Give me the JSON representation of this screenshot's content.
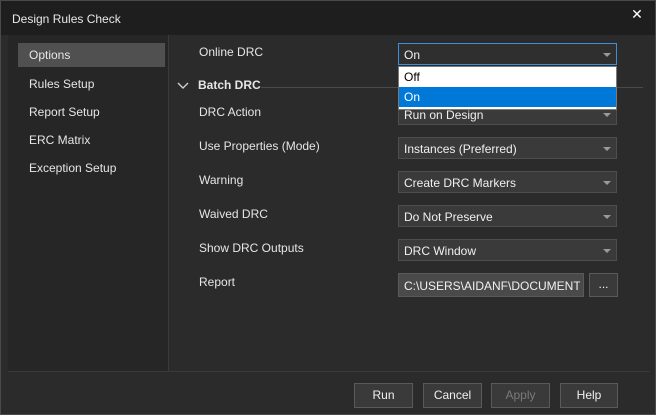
{
  "window": {
    "title": "Design Rules Check",
    "close_glyph": "✕"
  },
  "sidebar": {
    "items": [
      {
        "label": "Options",
        "selected": true
      },
      {
        "label": "Rules Setup"
      },
      {
        "label": "Report Setup"
      },
      {
        "label": "ERC Matrix"
      },
      {
        "label": "Exception Setup"
      }
    ]
  },
  "online_drc": {
    "label": "Online DRC",
    "value": "On",
    "options": [
      "Off",
      "On"
    ],
    "highlighted": "On"
  },
  "batch_drc": {
    "title": "Batch DRC",
    "fields": [
      {
        "label": "DRC Action",
        "value": "Run on Design"
      },
      {
        "label": "Use Properties (Mode)",
        "value": "Instances (Preferred)"
      },
      {
        "label": "Warning",
        "value": "Create DRC Markers"
      },
      {
        "label": "Waived DRC",
        "value": "Do Not Preserve"
      },
      {
        "label": "Show DRC Outputs",
        "value": "DRC Window"
      }
    ],
    "report": {
      "label": "Report",
      "value": "C:\\USERS\\AIDANF\\DOCUMENT",
      "browse": "..."
    }
  },
  "buttons": {
    "run": "Run",
    "cancel": "Cancel",
    "apply": "Apply",
    "help": "Help"
  },
  "icons": {
    "close": "close-icon",
    "collapse": "chevron-down-icon",
    "dropdown": "dropdown-arrow-icon"
  },
  "colors": {
    "accent": "#0078d7",
    "background": "#2b2b2b",
    "titlebar": "#1e1e1e"
  }
}
